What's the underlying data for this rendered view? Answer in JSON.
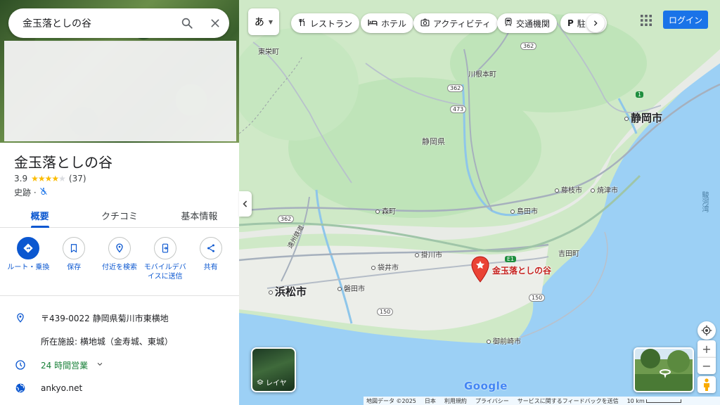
{
  "search": {
    "query": "金玉落としの谷"
  },
  "place": {
    "title": "金玉落としの谷",
    "rating": "3.9",
    "stars_filled": 4,
    "review_count": "(37)",
    "category": "史跡 ·"
  },
  "tabs": [
    {
      "label": "概要"
    },
    {
      "label": "クチコミ"
    },
    {
      "label": "基本情報"
    }
  ],
  "actions": [
    {
      "label": "ルート・乗換",
      "icon": "directions-icon"
    },
    {
      "label": "保存",
      "icon": "bookmark-icon"
    },
    {
      "label": "付近を検索",
      "icon": "nearby-icon"
    },
    {
      "label": "モバイルデバイスに送信",
      "icon": "send-to-phone-icon"
    },
    {
      "label": "共有",
      "icon": "share-icon"
    }
  ],
  "info": {
    "address": "〒439-0022 静岡県菊川市東横地",
    "located_in": "所在施設: 横地城（金寿城、東城）",
    "hours": "24 時間営業",
    "website": "ankyo.net"
  },
  "map": {
    "kana_label": "あ",
    "chips": [
      {
        "label": "レストラン",
        "icon": "restaurant-icon"
      },
      {
        "label": "ホテル",
        "icon": "hotel-icon"
      },
      {
        "label": "アクティビティ",
        "icon": "camera-icon"
      },
      {
        "label": "交通機関",
        "icon": "transit-icon"
      },
      {
        "label": "駐",
        "icon": "parking-icon"
      }
    ],
    "login_label": "ログイン",
    "layer_label": "レイヤ",
    "pin_label": "金玉落としの谷",
    "labels": {
      "higashisakae": "東栄町",
      "kawanemoto": "川根本町",
      "shizuoka_pref": "静岡県",
      "shizuoka_city": "静岡市",
      "fujieda": "藤枝市",
      "yaizu": "焼津市",
      "shimada": "島田市",
      "mori": "森町",
      "kakegawa": "掛川市",
      "fukuroi": "袋井市",
      "hamamatsu": "浜松市",
      "iwata": "磐田市",
      "yoshida": "吉田町",
      "omaezaki": "御前崎市",
      "suruga": "駿河湾",
      "route362a": "362",
      "route362b": "362",
      "route362c": "362",
      "route473": "473",
      "route1": "1",
      "route150a": "150",
      "route150b": "150",
      "routeE1": "E1",
      "expressway": "遠州鉄道"
    },
    "google_logo": "Google",
    "footer": [
      "地図データ ©2025",
      "日本",
      "利用規約",
      "プライバシー",
      "サービスに関するフィードバックを送信",
      "10 km"
    ]
  }
}
